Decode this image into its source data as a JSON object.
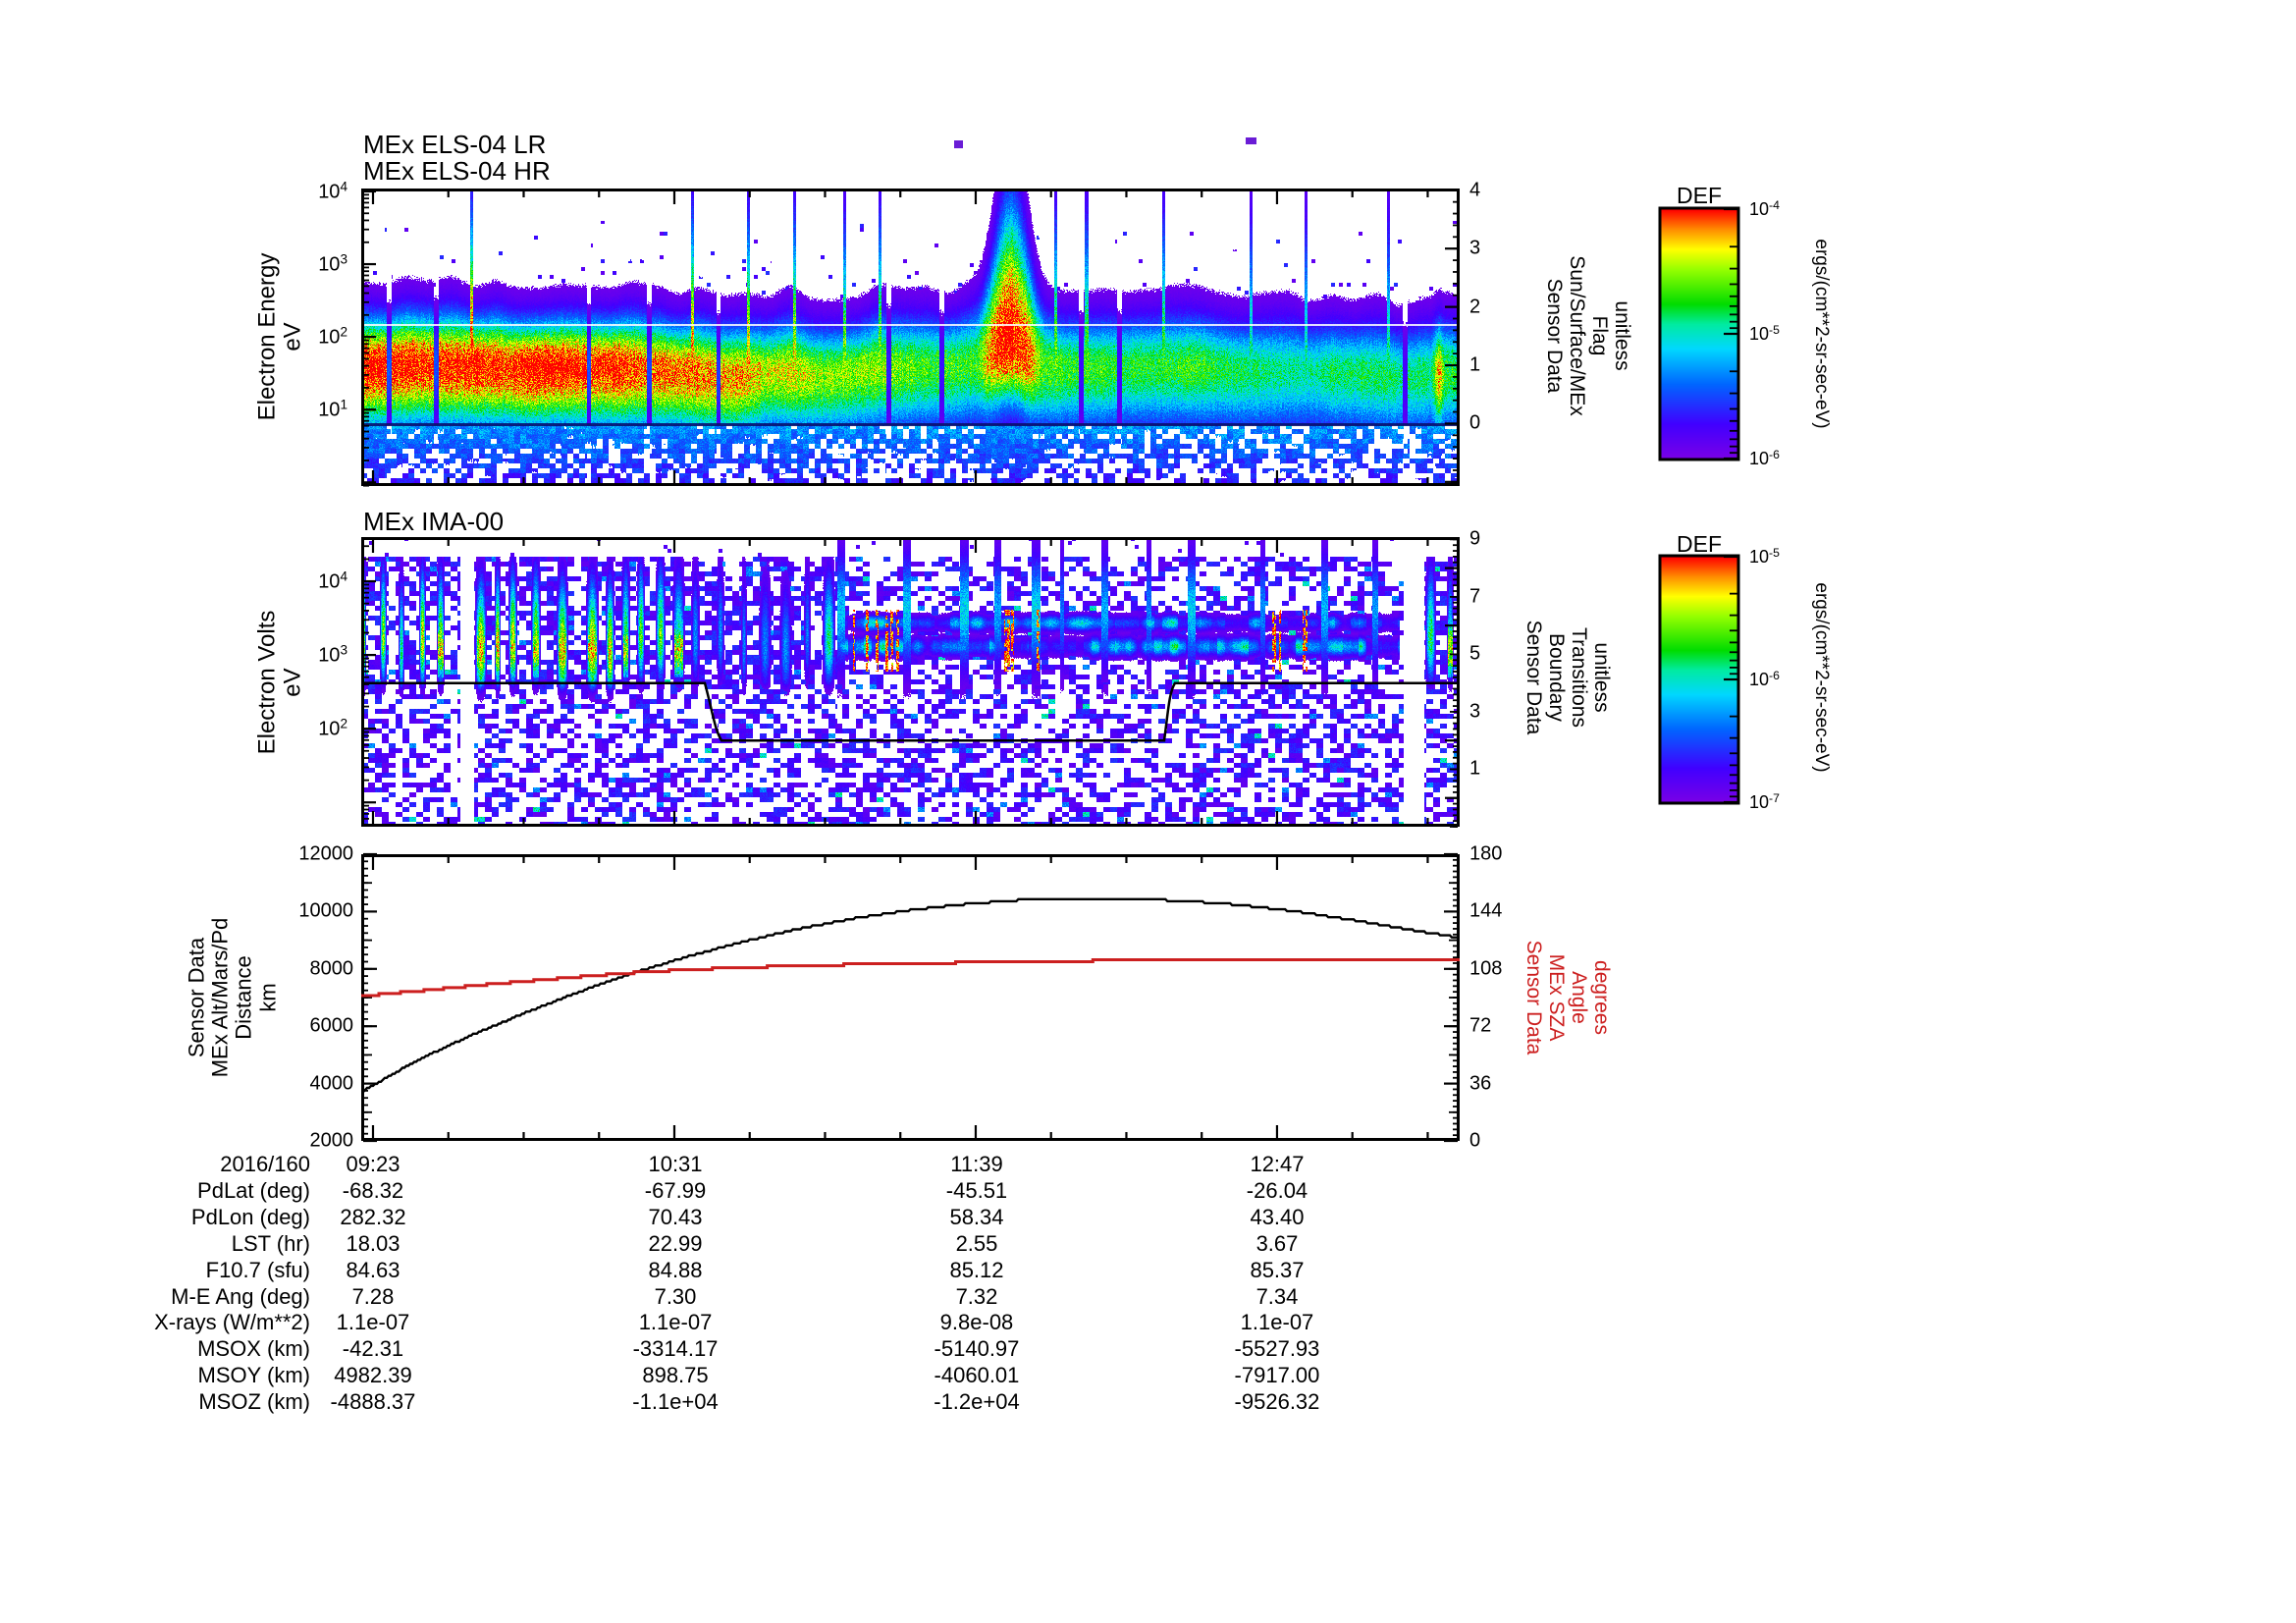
{
  "page": {
    "bg": "#ffffff",
    "text_color": "#000000",
    "accent_red": "#cc1f1f"
  },
  "panels": {
    "els": {
      "titles": [
        "MEx ELS-04 LR",
        "MEx ELS-04 HR"
      ],
      "ylabel_lines": [
        "Electron Energy",
        "eV"
      ],
      "ytick_exps": [
        "4",
        "3",
        "2",
        "1"
      ],
      "right_label_lines": [
        "Sensor Data",
        "Sun/Surface/MEx",
        "Flag",
        "unitless"
      ],
      "right_tick_values": [
        4,
        3,
        2,
        1,
        0
      ]
    },
    "ima": {
      "title": "MEx IMA-00",
      "ylabel_lines": [
        "Electron Volts",
        "eV"
      ],
      "ytick_exps": [
        "4",
        "3",
        "2"
      ],
      "right_label_lines": [
        "Sensor Data",
        "Boundary",
        "Transitions",
        "unitless"
      ],
      "right_tick_values": [
        9,
        7,
        5,
        3,
        1
      ]
    },
    "lines": {
      "ylabel_lines": [
        "Sensor Data",
        "MEx Alt/Mars/Pd",
        "Distance",
        "km"
      ],
      "ytick_values": [
        12000,
        10000,
        8000,
        6000,
        4000,
        2000
      ],
      "right_label_lines": [
        "Sensor Data",
        "MEx SZA",
        "Angle",
        "degrees"
      ],
      "right_tick_values": [
        180,
        144,
        108,
        72,
        36,
        0
      ]
    }
  },
  "colorbars": [
    {
      "title": "DEF",
      "unit": "ergs/(cm**2-sr-sec-eV)",
      "tick_exps": [
        "-4",
        "-5",
        "-6"
      ]
    },
    {
      "title": "DEF",
      "unit": "ergs/(cm**2-sr-sec-eV)",
      "tick_exps": [
        "-5",
        "-6",
        "-7"
      ]
    }
  ],
  "table": {
    "date_label": "2016/160",
    "time_columns": [
      "09:23",
      "10:31",
      "11:39",
      "12:47"
    ],
    "rows": [
      {
        "label": "PdLat (deg)",
        "values": [
          "-68.32",
          "-67.99",
          "-45.51",
          "-26.04"
        ]
      },
      {
        "label": "PdLon (deg)",
        "values": [
          "282.32",
          "70.43",
          "58.34",
          "43.40"
        ]
      },
      {
        "label": "LST (hr)",
        "values": [
          "18.03",
          "22.99",
          "2.55",
          "3.67"
        ]
      },
      {
        "label": "F10.7 (sfu)",
        "values": [
          "84.63",
          "84.88",
          "85.12",
          "85.37"
        ]
      },
      {
        "label": "M-E Ang (deg)",
        "values": [
          "7.28",
          "7.30",
          "7.32",
          "7.34"
        ]
      },
      {
        "label": "X-rays (W/m**2)",
        "values": [
          "1.1e-07",
          "1.1e-07",
          "9.8e-08",
          "1.1e-07"
        ]
      },
      {
        "label": "MSOX (km)",
        "values": [
          "-42.31",
          "-3314.17",
          "-5140.97",
          "-5527.93"
        ]
      },
      {
        "label": "MSOY (km)",
        "values": [
          "4982.39",
          "898.75",
          "-4060.01",
          "-7917.00"
        ]
      },
      {
        "label": "MSOZ (km)",
        "values": [
          "-4888.37",
          "-1.1e+04",
          "-1.2e+04",
          "-9526.32"
        ]
      }
    ]
  },
  "chart_data": [
    {
      "type": "heatmap",
      "panel": "els",
      "title": "MEx ELS-04 LR / MEx ELS-04 HR",
      "ylabel": "Electron Energy (eV)",
      "y_scale": "log",
      "y_range": [
        1,
        10000
      ],
      "x_range_time": [
        "09:20",
        "13:28"
      ],
      "x_tick_times": [
        "09:23",
        "10:31",
        "11:39",
        "12:47"
      ],
      "value_label": "DEF ergs/(cm**2-sr-sec-eV)",
      "value_range": [
        1e-06,
        0.0001
      ],
      "right_axis": {
        "label": "Sensor Data Sun/Surface/MEx Flag (unitless)",
        "range": [
          -1.07,
          4.03
        ],
        "ticks": [
          0,
          1,
          2,
          3,
          4
        ]
      },
      "features": {
        "main_band_log_center": 1.5,
        "intense_red_until_frac": 0.37,
        "burst_frac": [
          0.578,
          0.605
        ],
        "white_slots_frac": [
          0.025,
          0.068,
          0.207,
          0.262,
          0.325,
          0.48,
          0.528,
          0.655,
          0.69,
          0.95
        ],
        "green_spike_fracs": [
          0.1,
          0.301,
          0.352,
          0.394,
          0.44,
          0.472,
          0.632,
          0.66,
          0.73,
          0.81,
          0.86,
          0.935
        ],
        "white_line_log_e": 2.18,
        "dark_line_log_e": 0.8
      }
    },
    {
      "type": "heatmap",
      "panel": "ima",
      "title": "MEx IMA-00",
      "ylabel": "Electron Volts (eV)",
      "y_scale": "log",
      "y_range": [
        5,
        40000
      ],
      "x_tick_times": [
        "09:23",
        "10:31",
        "11:39",
        "12:47"
      ],
      "value_label": "DEF ergs/(cm**2-sr-sec-eV)",
      "value_range": [
        1e-07,
        1e-05
      ],
      "right_axis": {
        "label": "Sensor Data Boundary Transitions (unitless)",
        "range": [
          -1.0,
          9.08
        ],
        "ticks": [
          1,
          3,
          5,
          7,
          9
        ]
      },
      "features": {
        "data_gaps_frac": [
          [
            0.0894,
            0.1019
          ],
          [
            0.949,
            0.967
          ]
        ],
        "stripe_regions_frac": [
          [
            0,
            0.0894
          ],
          [
            0.1019,
            0.3
          ],
          [
            0.3,
            0.422
          ],
          [
            0.967,
            1.0
          ]
        ],
        "band_region_frac": [
          0.433,
          0.945
        ],
        "bands_log_center": [
          3.12,
          3.44
        ],
        "red_streak_clusters_frac": [
          [
            0.44,
            0.5
          ],
          [
            0.58,
            0.63
          ],
          [
            0.825,
            0.865
          ]
        ],
        "boundary_line": {
          "values": [
            4,
            2,
            4
          ],
          "drop_frac": [
            0.313,
            0.328
          ],
          "rise_frac": [
            0.731,
            0.741
          ]
        }
      }
    },
    {
      "type": "line",
      "panel": "lines",
      "y_axis": {
        "label": "Sensor Data MEx Alt/Mars/Pd Distance (km)",
        "range": [
          2000,
          12000
        ]
      },
      "right_axis": {
        "label": "Sensor Data MEx SZA Angle (degrees)",
        "range": [
          0,
          180
        ]
      },
      "x_tick_times": [
        "09:23",
        "10:31",
        "11:39",
        "12:47"
      ],
      "series": [
        {
          "name": "MEx Alt/Mars/Pd Distance",
          "unit": "km",
          "color": "#000000",
          "axis": "left",
          "quantize": 70,
          "points": [
            [
              0,
              3700
            ],
            [
              0.05,
              4790
            ],
            [
              0.1,
              5680
            ],
            [
              0.15,
              6480
            ],
            [
              0.2,
              7220
            ],
            [
              0.25,
              7890
            ],
            [
              0.3,
              8460
            ],
            [
              0.35,
              8970
            ],
            [
              0.4,
              9410
            ],
            [
              0.45,
              9770
            ],
            [
              0.5,
              10050
            ],
            [
              0.55,
              10260
            ],
            [
              0.6,
              10400
            ],
            [
              0.65,
              10460
            ],
            [
              0.7,
              10440
            ],
            [
              0.75,
              10370
            ],
            [
              0.8,
              10230
            ],
            [
              0.85,
              10010
            ],
            [
              0.9,
              9720
            ],
            [
              0.95,
              9400
            ],
            [
              1,
              9080
            ]
          ]
        },
        {
          "name": "MEx SZA Angle",
          "unit": "degrees",
          "color": "#cc1f1f",
          "axis": "right",
          "quantize": 1.25,
          "points": [
            [
              0,
              91
            ],
            [
              0.05,
              94
            ],
            [
              0.1,
              97.3
            ],
            [
              0.15,
              100.3
            ],
            [
              0.2,
              103.2
            ],
            [
              0.25,
              105.8
            ],
            [
              0.3,
              107.6
            ],
            [
              0.35,
              109
            ],
            [
              0.4,
              110
            ],
            [
              0.45,
              110.8
            ],
            [
              0.5,
              111.4
            ],
            [
              0.55,
              112
            ],
            [
              0.6,
              112.5
            ],
            [
              0.65,
              113
            ],
            [
              0.7,
              113.4
            ],
            [
              0.75,
              113.7
            ],
            [
              0.8,
              114
            ],
            [
              0.85,
              114.1
            ],
            [
              0.9,
              114.2
            ],
            [
              0.95,
              114.25
            ],
            [
              1,
              114.3
            ]
          ]
        }
      ]
    },
    {
      "type": "table",
      "title": "Context values at major time ticks",
      "ref": "table"
    }
  ]
}
